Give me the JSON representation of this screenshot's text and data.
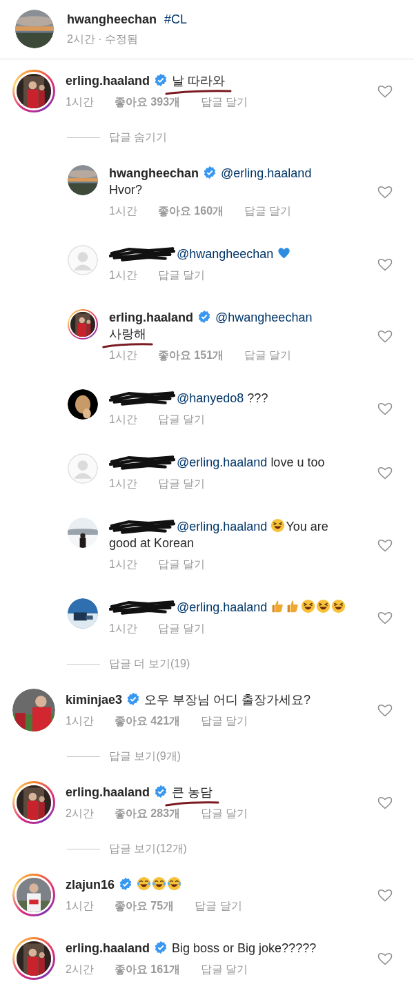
{
  "post": {
    "avatar": {
      "kind": "picture",
      "story_ring": false
    },
    "username": "hwangheechan",
    "caption": "#CL",
    "time": "2시간 · 수정됨"
  },
  "comments": [
    {
      "avatar": {
        "kind": "picture",
        "story_ring": true
      },
      "username": "erling.haaland",
      "redacted": false,
      "verified": true,
      "body": [
        {
          "kind": "text",
          "text": "날 따라와",
          "underlined": true
        }
      ],
      "time": "1시간",
      "likes": "좋아요 393개",
      "reply_label": "답글 달기",
      "replies_toggle": "답글 숨기기",
      "replies": [
        {
          "avatar": {
            "kind": "picture",
            "story_ring": false
          },
          "username": "hwangheechan",
          "redacted": false,
          "verified": true,
          "body": [
            {
              "kind": "mention",
              "text": "@erling.haaland"
            },
            {
              "kind": "text",
              "text": "Hvor?",
              "underlined": false,
              "newline": true
            }
          ],
          "time": "1시간",
          "likes": "좋아요 160개",
          "reply_label": "답글 달기"
        },
        {
          "avatar": {
            "kind": "default",
            "story_ring": false
          },
          "redacted": true,
          "verified": false,
          "body": [
            {
              "kind": "mention",
              "text": "@hwangheechan"
            },
            {
              "kind": "blue-heart"
            }
          ],
          "time": "1시간",
          "reply_label": "답글 달기"
        },
        {
          "avatar": {
            "kind": "picture",
            "story_ring": true
          },
          "username": "erling.haaland",
          "redacted": false,
          "verified": true,
          "body": [
            {
              "kind": "mention",
              "text": "@hwangheechan"
            },
            {
              "kind": "text",
              "text": "사랑해",
              "underlined": true,
              "newline": true
            }
          ],
          "time": "1시간",
          "likes": "좋아요 151개",
          "reply_label": "답글 달기"
        },
        {
          "avatar": {
            "kind": "picture",
            "story_ring": false
          },
          "redacted": true,
          "verified": false,
          "body": [
            {
              "kind": "mention",
              "text": "@hanyedo8"
            },
            {
              "kind": "text",
              "text": "???",
              "underlined": false
            }
          ],
          "time": "1시간",
          "reply_label": "답글 달기"
        },
        {
          "avatar": {
            "kind": "default",
            "story_ring": false
          },
          "redacted": true,
          "verified": false,
          "body": [
            {
              "kind": "mention",
              "text": "@erling.haaland"
            },
            {
              "kind": "text",
              "text": "love u too",
              "underlined": false
            }
          ],
          "time": "1시간",
          "reply_label": "답글 달기"
        },
        {
          "avatar": {
            "kind": "picture",
            "story_ring": false
          },
          "redacted": true,
          "verified": false,
          "body": [
            {
              "kind": "mention",
              "text": "@erling.haaland"
            },
            {
              "kind": "squint-laugh"
            },
            {
              "kind": "text",
              "text": "You are",
              "underlined": false
            },
            {
              "kind": "text",
              "text": "good at Korean",
              "underlined": false,
              "newline": true
            }
          ],
          "time": "1시간",
          "reply_label": "답글 달기"
        },
        {
          "avatar": {
            "kind": "picture",
            "story_ring": false
          },
          "redacted": true,
          "verified": false,
          "body": [
            {
              "kind": "mention",
              "text": "@erling.haaland"
            },
            {
              "kind": "thumbs-up"
            },
            {
              "kind": "thumbs-up"
            },
            {
              "kind": "squint-laugh"
            },
            {
              "kind": "squint-laugh"
            },
            {
              "kind": "squint-laugh"
            }
          ],
          "time": "1시간",
          "reply_label": "답글 달기"
        }
      ],
      "more_replies": "답글 더 보기(19)"
    },
    {
      "avatar": {
        "kind": "picture",
        "story_ring": false
      },
      "username": "kiminjae3",
      "redacted": false,
      "verified": true,
      "body": [
        {
          "kind": "text",
          "text": "오우 부장님 어디 출장가세요?",
          "underlined": false
        }
      ],
      "time": "1시간",
      "likes": "좋아요 421개",
      "reply_label": "답글 달기",
      "replies_toggle": "답글 보기(9개)"
    },
    {
      "avatar": {
        "kind": "picture",
        "story_ring": true
      },
      "username": "erling.haaland",
      "redacted": false,
      "verified": true,
      "body": [
        {
          "kind": "text",
          "text": "큰 농담",
          "underlined": true
        }
      ],
      "time": "2시간",
      "likes": "좋아요 283개",
      "reply_label": "답글 달기",
      "replies_toggle": "답글 보기(12개)"
    },
    {
      "avatar": {
        "kind": "picture",
        "story_ring": true
      },
      "username": "zlajun16",
      "redacted": false,
      "verified": true,
      "body": [
        {
          "kind": "tears-joy"
        },
        {
          "kind": "tears-joy"
        },
        {
          "kind": "tears-joy"
        }
      ],
      "time": "1시간",
      "likes": "좋아요 75개",
      "reply_label": "답글 달기"
    },
    {
      "avatar": {
        "kind": "picture",
        "story_ring": true
      },
      "username": "erling.haaland",
      "redacted": false,
      "verified": true,
      "body": [
        {
          "kind": "text",
          "text": "Big boss or Big joke?????",
          "underlined": false
        }
      ],
      "time": "2시간",
      "likes": "좋아요 161개",
      "reply_label": "답글 달기"
    }
  ]
}
